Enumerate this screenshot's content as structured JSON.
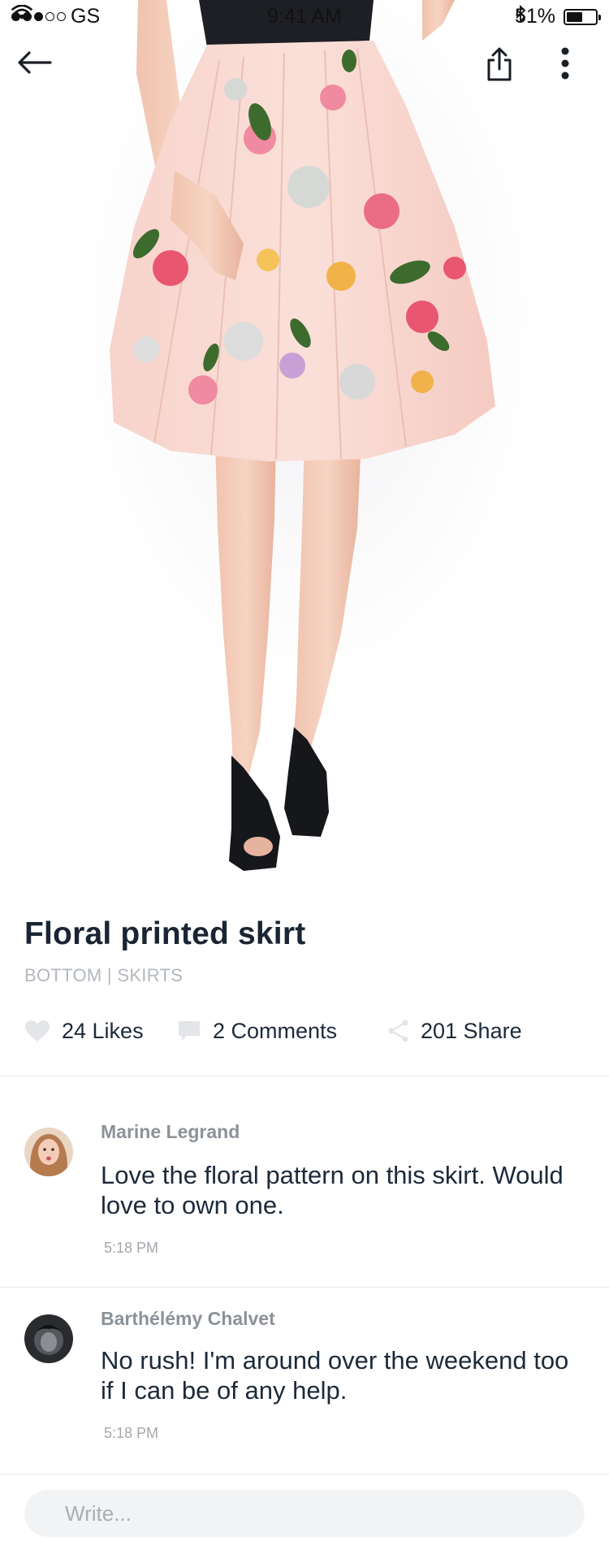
{
  "status_bar": {
    "carrier": "GS",
    "time": "9:41 AM",
    "battery": "51%"
  },
  "icons": {
    "back": "arrow-left-icon",
    "share": "share-upload-icon",
    "more": "more-vertical-icon",
    "like": "heart-icon",
    "comment": "comment-bubble-icon",
    "share_count": "share-nodes-icon"
  },
  "product": {
    "title": "Floral printed skirt",
    "category": "BOTTOM | SKIRTS"
  },
  "stats": {
    "likes": "24 Likes",
    "comments": "2 Comments",
    "shares": "201 Share"
  },
  "comments": [
    {
      "author": "Marine Legrand",
      "text": "Love the floral pattern on this skirt. Would love to own one.",
      "time": "5:18 PM"
    },
    {
      "author": "Barthélémy Chalvet",
      "text": "No rush! I'm around over the weekend too if I can be of any help.",
      "time": "5:18 PM"
    }
  ],
  "composer": {
    "placeholder": "Write..."
  },
  "colors": {
    "title": "#1a2533",
    "muted": "#b3b8be",
    "skirt": "#f6cfc8",
    "input_bg": "#f2f3f5"
  }
}
